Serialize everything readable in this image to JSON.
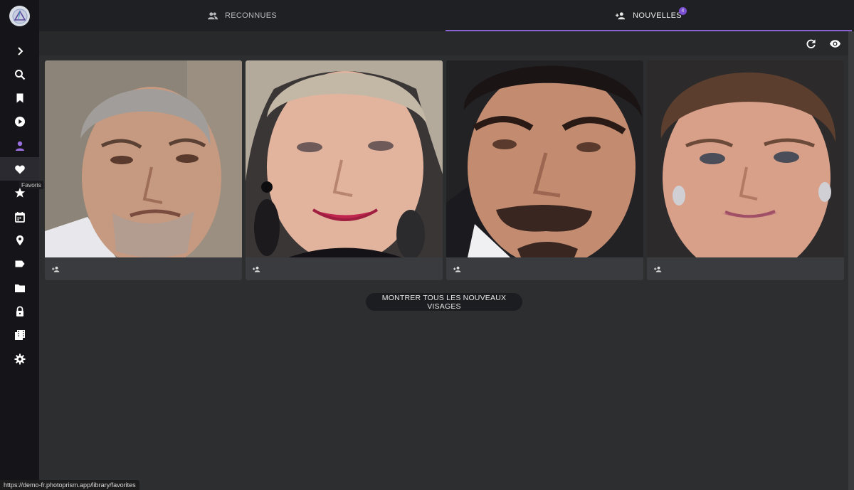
{
  "tabs": {
    "recognized": "RECONNUES",
    "new": "NOUVELLES",
    "new_count": "4"
  },
  "sidebar": {
    "tooltip": "Favoris",
    "items": [
      "expand",
      "search",
      "bookmark",
      "play",
      "people",
      "favorites",
      "star",
      "calendar",
      "location",
      "label",
      "folder",
      "lock",
      "film",
      "settings"
    ]
  },
  "toolbar": {
    "refresh_icon": "refresh-icon",
    "eye_icon": "eye-icon"
  },
  "cards": [
    {
      "icon": "add-person-icon"
    },
    {
      "icon": "add-person-icon"
    },
    {
      "icon": "add-person-icon"
    },
    {
      "icon": "add-person-icon"
    }
  ],
  "actions": {
    "show_all": "MONTRER TOUS LES NOUVEAUX VISAGES"
  },
  "status_url": "https://demo-fr.photoprism.app/library/favorites",
  "colors": {
    "accent": "#8a63d2",
    "sidebar_bg": "#151519",
    "content_bg": "#2d2e30"
  }
}
